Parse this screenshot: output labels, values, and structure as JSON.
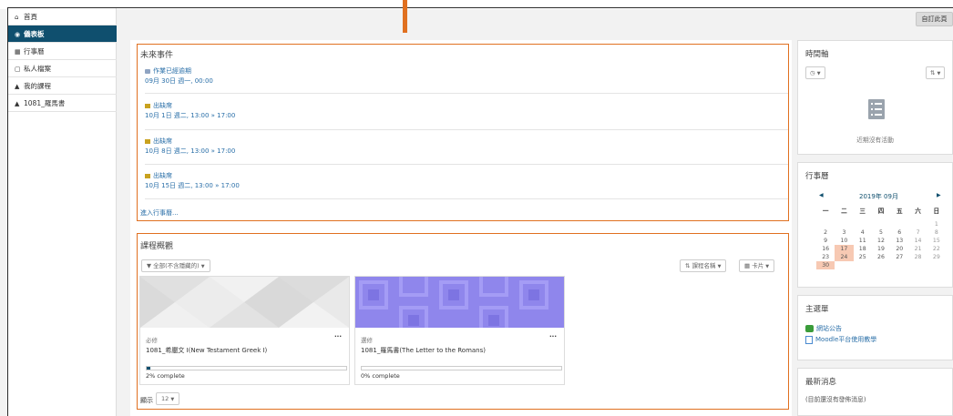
{
  "sidebar": {
    "items": [
      {
        "icon": "home-icon",
        "glyph": "⌂",
        "label": "首頁"
      },
      {
        "icon": "dashboard-icon",
        "glyph": "◉",
        "label": "儀表板"
      },
      {
        "icon": "calendar-icon",
        "glyph": "▦",
        "label": "行事曆"
      },
      {
        "icon": "file-icon",
        "glyph": "▢",
        "label": "私人檔案"
      },
      {
        "icon": "graduation-cap-icon",
        "glyph": "▲",
        "label": "我的課程"
      },
      {
        "icon": "graduation-cap-icon",
        "glyph": "▲",
        "label": "1081_羅馬書"
      }
    ]
  },
  "toolbar": {
    "customize_label": "自訂此頁"
  },
  "upcoming": {
    "title": "未來事件",
    "events": [
      {
        "name": "作業已經逾期",
        "time": "09月 30日 週一, 00:00",
        "icon": "assignment-icon"
      },
      {
        "name": "出缺席",
        "time": "10月 1日 週二, 13:00 » 17:00",
        "icon": "attendance-icon"
      },
      {
        "name": "出缺席",
        "time": "10月 8日 週二, 13:00 » 17:00",
        "icon": "attendance-icon"
      },
      {
        "name": "出缺席",
        "time": "10月 15日 週二, 13:00 » 17:00",
        "icon": "attendance-icon"
      }
    ],
    "goto_calendar": "進入行事曆..."
  },
  "overview": {
    "title": "課程概觀",
    "filter_label": "全部(不含隱藏的)",
    "sort_label": "課程名稱",
    "view_label": "卡片",
    "courses": [
      {
        "tag": "必修",
        "name": "1081_希臘文 I(New Testament Greek I)",
        "progress_label": "2% complete",
        "progress": 2,
        "pattern": "triangles"
      },
      {
        "tag": "選修",
        "name": "1081_羅馬書(The Letter to the Romans)",
        "progress_label": "0% complete",
        "progress": 0,
        "pattern": "squares"
      }
    ],
    "show_label": "顯示",
    "show_count": "12"
  },
  "timeline": {
    "title": "時間軸",
    "empty_text": "近期沒有活動"
  },
  "calendar": {
    "title": "行事曆",
    "month": "2019年 09月",
    "weekdays": [
      "一",
      "二",
      "三",
      "四",
      "五",
      "六",
      "日"
    ],
    "weeks": [
      [
        "",
        "",
        "",
        "",
        "",
        "",
        "1"
      ],
      [
        "2",
        "3",
        "4",
        "5",
        "6",
        "7",
        "8"
      ],
      [
        "9",
        "10",
        "11",
        "12",
        "13",
        "14",
        "15"
      ],
      [
        "16",
        "17",
        "18",
        "19",
        "20",
        "21",
        "22"
      ],
      [
        "23",
        "24",
        "25",
        "26",
        "27",
        "28",
        "29"
      ],
      [
        "30",
        "",
        "",
        "",
        "",
        "",
        ""
      ]
    ],
    "highlighted": [
      "17",
      "24",
      "30"
    ]
  },
  "main_menu": {
    "title": "主選單",
    "items": [
      {
        "label": "網站公告",
        "icon": "forum-icon",
        "color": "#3a9c3a"
      },
      {
        "label": "Moodle平台使用教學",
        "icon": "document-icon",
        "color": "#4a8ad0"
      }
    ]
  },
  "news": {
    "title": "最新消息",
    "empty_text": "(目前還沒有發佈消息)"
  },
  "colors": {
    "accent": "#0f4f6e",
    "highlight_border": "#e07020",
    "link": "#2a6fa8",
    "calendar_highlight": "#f7c9b3"
  }
}
